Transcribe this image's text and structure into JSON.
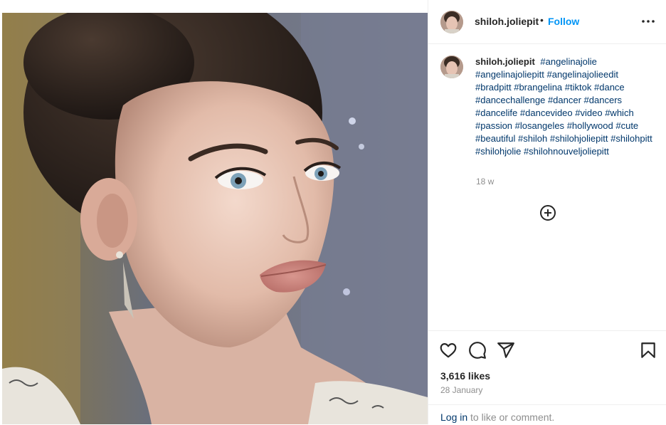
{
  "post": {
    "image_alt": "Close-up portrait photo of a young girl with hair in a bun and ear cuff earrings",
    "username": "shiloh.joliepit",
    "separator": "•",
    "follow_label": "Follow",
    "more_icon": "more-horizontal-icon"
  },
  "caption": {
    "username": "shiloh.joliepit",
    "hashtags": [
      "#angelinajolie",
      "#angelinajoliepitt",
      "#angelinajolieedit",
      "#bradpitt",
      "#brangelina",
      "#tiktok",
      "#dance",
      "#dancechallenge",
      "#dancer",
      "#dancers",
      "#dancelife",
      "#dancevideo",
      "#video",
      "#which",
      "#passion",
      "#losangeles",
      "#hollywood",
      "#cute",
      "#beautiful",
      "#shiloh",
      "#shilohjoliepitt",
      "#shilohpitt",
      "#shilohjolie",
      "#shilohnouveljoliepitt"
    ],
    "time_ago": "18 w"
  },
  "actions": {
    "like_icon": "heart-icon",
    "comment_icon": "comment-icon",
    "share_icon": "share-icon",
    "save_icon": "bookmark-icon",
    "load_more_icon": "plus-circle-icon"
  },
  "stats": {
    "likes": "3,616 likes",
    "date": "28 January"
  },
  "login": {
    "link_label": "Log in",
    "rest_text": " to like or comment."
  },
  "colors": {
    "link_blue": "#0095f6",
    "hashtag_blue": "#00376b",
    "muted_gray": "#8e8e8e",
    "text_dark": "#262626",
    "divider": "#efefef"
  }
}
